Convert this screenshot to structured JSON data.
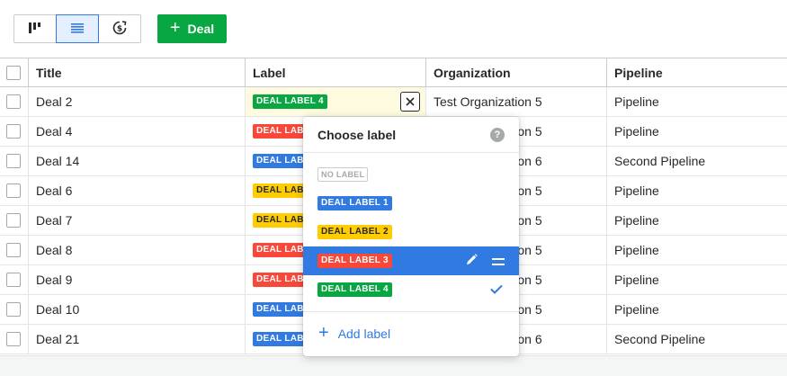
{
  "toolbar": {
    "views": [
      {
        "icon": "pipeline-view-icon",
        "active": false
      },
      {
        "icon": "list-view-icon",
        "active": true
      },
      {
        "icon": "forecast-view-icon",
        "active": false
      }
    ],
    "add_deal_plus": "+",
    "add_deal_label": "Deal",
    "accent": "#08a742"
  },
  "table": {
    "columns": [
      "Title",
      "Label",
      "Organization",
      "Pipeline"
    ],
    "rows": [
      {
        "title": "Deal 2",
        "label": "DEAL LABEL 4",
        "label_color": "#08a742",
        "org": "Test Organization 5",
        "pipeline": "Pipeline"
      },
      {
        "title": "Deal 4",
        "label": "DEAL LABEL 3",
        "label_color": "#f94839",
        "org": "Test Organization 5",
        "pipeline": "Pipeline"
      },
      {
        "title": "Deal 14",
        "label": "DEAL LABEL 1",
        "label_color": "#317ae2",
        "org": "Test Organization 6",
        "pipeline": "Second Pipeline"
      },
      {
        "title": "Deal 6",
        "label": "DEAL LABEL 2",
        "label_color": "#ffcc00",
        "org": "Test Organization 5",
        "pipeline": "Pipeline"
      },
      {
        "title": "Deal 7",
        "label": "DEAL LABEL 2",
        "label_color": "#ffcc00",
        "org": "Test Organization 5",
        "pipeline": "Pipeline"
      },
      {
        "title": "Deal 8",
        "label": "DEAL LABEL 3",
        "label_color": "#f94839",
        "org": "Test Organization 5",
        "pipeline": "Pipeline"
      },
      {
        "title": "Deal 9",
        "label": "DEAL LABEL 3",
        "label_color": "#f94839",
        "org": "Test Organization 5",
        "pipeline": "Pipeline"
      },
      {
        "title": "Deal 10",
        "label": "DEAL LABEL 1",
        "label_color": "#317ae2",
        "org": "Test Organization 5",
        "pipeline": "Pipeline"
      },
      {
        "title": "Deal 21",
        "label": "DEAL LABEL 1",
        "label_color": "#317ae2",
        "org": "Test Organization 6",
        "pipeline": "Second Pipeline"
      }
    ]
  },
  "label_picker": {
    "title": "Choose label",
    "help": "?",
    "options": [
      {
        "label": "NO LABEL",
        "color": "#ffffff",
        "state": "none"
      },
      {
        "label": "DEAL LABEL 1",
        "color": "#317ae2",
        "state": "normal"
      },
      {
        "label": "DEAL LABEL 2",
        "color": "#ffcc00",
        "state": "normal"
      },
      {
        "label": "DEAL LABEL 3",
        "color": "#f94839",
        "state": "hovered"
      },
      {
        "label": "DEAL LABEL 4",
        "color": "#08a742",
        "state": "checked"
      }
    ],
    "add_plus": "+",
    "add_label": "Add label"
  }
}
